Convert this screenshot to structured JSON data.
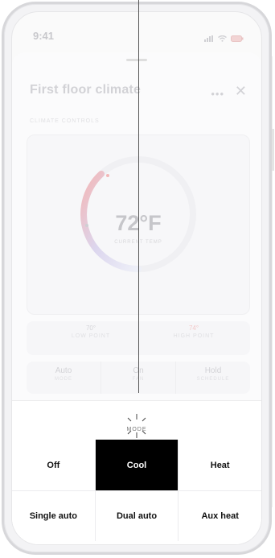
{
  "status_bar": {
    "time": "9:41"
  },
  "sheet": {
    "title": "First floor climate",
    "more_icon": "more-horizontal-icon",
    "close_icon": "close-icon",
    "section_label": "CLIMATE CONTROLS"
  },
  "thermostat": {
    "temperature": "72°F",
    "caption": "CURRENT TEMP",
    "low_point": {
      "value": "70°",
      "label": "LOW POINT"
    },
    "high_point": {
      "value": "74°",
      "label": "HIGH POINT"
    }
  },
  "controls": [
    {
      "value": "Auto",
      "label": "MODE"
    },
    {
      "value": "On",
      "label": "FAN"
    },
    {
      "value": "Hold",
      "label": "SCHEDULE"
    }
  ],
  "mode_picker": {
    "title": "MODE",
    "selected": "Cool",
    "rows": [
      [
        "Off",
        "Cool",
        "Heat"
      ],
      [
        "Single auto",
        "Dual auto",
        "Aux heat"
      ]
    ]
  },
  "colors": {
    "selected_bg": "#000000",
    "selected_text": "#ffffff",
    "high_point": "#f2c8c8",
    "dial_warm": "#f3b7b7",
    "dial_cool": "#c9d6f2"
  }
}
